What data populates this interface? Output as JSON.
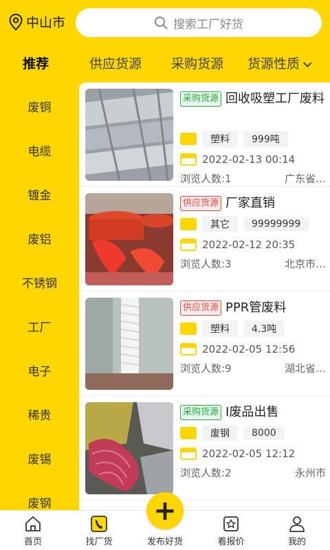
{
  "header": {
    "location": "中山市",
    "search_placeholder": "搜索工厂好货"
  },
  "tabs": [
    "推荐",
    "供应货源",
    "采购货源",
    "货源性质"
  ],
  "sidebar": [
    "废铜",
    "电缆",
    "镀金",
    "废铝",
    "不锈钢",
    "工厂",
    "电子",
    "稀贵",
    "废锡",
    "废钢"
  ],
  "listings": [
    {
      "tag": "采购货源",
      "tag_type": "buy",
      "title": "回收吸塑工厂废料",
      "category": "塑料",
      "quantity": "999吨",
      "date": "2022-02-13 00:14",
      "views": "浏览人数:1",
      "region": "广东省…"
    },
    {
      "tag": "供应货源",
      "tag_type": "supply",
      "title": "厂家直销",
      "category": "其它",
      "quantity": "99999999",
      "date": "2022-02-12 20:35",
      "views": "浏览人数:3",
      "region": "北京市…"
    },
    {
      "tag": "供应货源",
      "tag_type": "supply",
      "title": "PPR管废料",
      "category": "塑料",
      "quantity": "4.3吨",
      "date": "2022-02-05 12:56",
      "views": "浏览人数:9",
      "region": "湖北省…"
    },
    {
      "tag": "采购货源",
      "tag_type": "buy",
      "title": "I废品出售",
      "category": "废钢",
      "quantity": "8000",
      "date": "2022-02-05 12:12",
      "views": "浏览人数:2",
      "region": "永州市"
    }
  ],
  "bottom_nav": [
    "首页",
    "找厂货",
    "发布好货",
    "看报价",
    "我的"
  ],
  "colors": {
    "accent": "#ffd600",
    "buy_tag": "#1faa3a",
    "supply_tag": "#e2483d"
  }
}
